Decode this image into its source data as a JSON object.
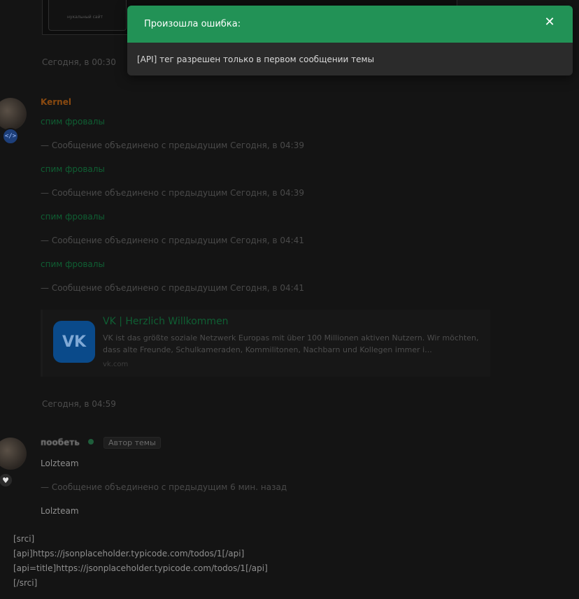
{
  "colors": {
    "accent_green": "#229256",
    "link_green": "#0f5f33",
    "kernel_orange": "#8a4a10",
    "background": "#141414"
  },
  "image_card": {
    "caption": "нукальный сайт"
  },
  "post1": {
    "time": "Сегодня, в 00:30"
  },
  "post2": {
    "username": "Kernel",
    "avatar_badge_icon": "code-icon",
    "avatar_badge_glyph": "</>",
    "lines": [
      {
        "text": "спим фровалы",
        "merged": "— Сообщение объединено с предыдущим Сегодня, в 04:39"
      },
      {
        "text": "спим фровалы",
        "merged": "— Сообщение объединено с предыдущим Сегодня, в 04:39"
      },
      {
        "text": "спим фровалы",
        "merged": "— Сообщение объединено с предыдущим Сегодня, в 04:41"
      },
      {
        "text": "спим фровалы",
        "merged": "— Сообщение объединено с предыдущим Сегодня, в 04:41"
      }
    ],
    "embed": {
      "logo": "VK",
      "title": "VK | Herzlich Willkommen",
      "description": "VK ist das größte soziale Netzwerk Europas mit über 100 Millionen aktiven Nutzern. Wir möchten, dass alte Freunde, Schulkameraden, Kommilitonen, Nachbarn und Kollegen immer i...",
      "domain": "vk.com"
    },
    "time": "Сегодня, в 04:59"
  },
  "post3": {
    "username": "пообеть",
    "author_tag": "Автор темы",
    "avatar_badge_icon": "heart-icon",
    "avatar_badge_glyph": "♥",
    "line1": "Lolzteam",
    "merged": "— Сообщение объединено с предыдущим 6 мин. назад",
    "line2": "Lolzteam"
  },
  "code_lines": [
    "[srci]",
    "[api]https://jsonplaceholder.typicode.com/todos/1[/api]",
    "[api=title]https://jsonplaceholder.typicode.com/todos/1[/api]",
    "[/srci]"
  ],
  "notification": {
    "title": "Произошла ошибка:",
    "close_glyph": "✕",
    "message": "[API] тег разрешен только в первом сообщении темы"
  }
}
